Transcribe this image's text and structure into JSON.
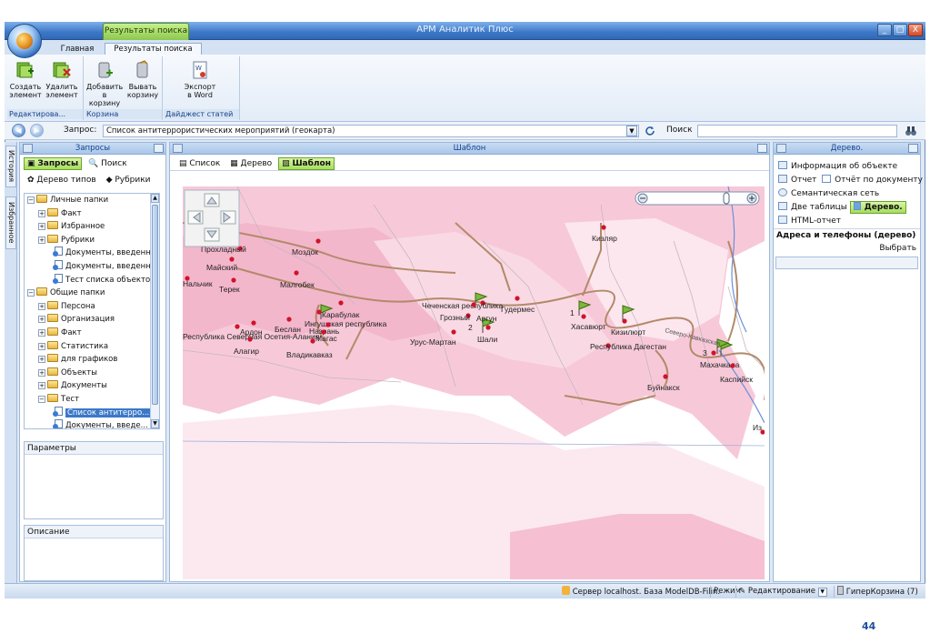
{
  "window": {
    "title": "АРМ Аналитик Плюс",
    "context_tab": "Результаты поиска",
    "controls": [
      "_",
      "□",
      "X"
    ]
  },
  "tabs": [
    "Главная",
    "Результаты поиска"
  ],
  "ribbon": {
    "groups": [
      {
        "label": "Редактирова...",
        "buttons": [
          {
            "line1": "Создать",
            "line2": "элемент"
          },
          {
            "line1": "Удалить",
            "line2": "элемент"
          }
        ]
      },
      {
        "label": "Корзина",
        "buttons": [
          {
            "line1": "Добавить",
            "line2": "в корзину"
          },
          {
            "line1": "Вывать",
            "line2": "корзину"
          }
        ]
      },
      {
        "label": "Дайджест статей",
        "buttons": [
          {
            "line1": "Экспорт",
            "line2": "в Word"
          }
        ]
      }
    ]
  },
  "querybar": {
    "label": "Запрос:",
    "value": "Список антитеррористических мероприятий (геокарта)",
    "search_label": "Поиск",
    "search_value": ""
  },
  "sidetabs": [
    "История",
    "Избранное"
  ],
  "left_panel": {
    "title": "Запросы",
    "toolbar": [
      "Запросы",
      "Поиск",
      "Дерево типов",
      "Рубрики"
    ],
    "tree": [
      {
        "text": "Личные папки",
        "level": 0,
        "type": "folder",
        "exp": "−"
      },
      {
        "text": "Факт",
        "level": 1,
        "type": "folder",
        "exp": "+"
      },
      {
        "text": "Избранное",
        "level": 1,
        "type": "folder",
        "exp": "+"
      },
      {
        "text": "Рубрики",
        "level": 1,
        "type": "folder",
        "exp": "+"
      },
      {
        "text": "Документы, введенн...",
        "level": 2,
        "type": "doc",
        "exp": ""
      },
      {
        "text": "Документы, введенн...",
        "level": 2,
        "type": "doc",
        "exp": ""
      },
      {
        "text": "Тест списка объектов",
        "level": 2,
        "type": "doc",
        "exp": ""
      },
      {
        "text": "Общие папки",
        "level": 0,
        "type": "folder",
        "exp": "−"
      },
      {
        "text": "Персона",
        "level": 1,
        "type": "folder",
        "exp": "+"
      },
      {
        "text": "Организация",
        "level": 1,
        "type": "folder",
        "exp": "+"
      },
      {
        "text": "Факт",
        "level": 1,
        "type": "folder",
        "exp": "+"
      },
      {
        "text": "Статистика",
        "level": 1,
        "type": "folder",
        "exp": "+"
      },
      {
        "text": "для графиков",
        "level": 1,
        "type": "folder",
        "exp": "+"
      },
      {
        "text": "Объекты",
        "level": 1,
        "type": "folder",
        "exp": "+"
      },
      {
        "text": "Документы",
        "level": 1,
        "type": "folder",
        "exp": "+"
      },
      {
        "text": "Тест",
        "level": 1,
        "type": "folder",
        "exp": "−"
      },
      {
        "text": "Список антитерро...",
        "level": 2,
        "type": "doc",
        "exp": "",
        "selected": true
      },
      {
        "text": "Документы, введе...",
        "level": 2,
        "type": "doc",
        "exp": ""
      }
    ],
    "params_label": "Параметры",
    "desc_label": "Описание"
  },
  "center_panel": {
    "title": "Шаблон",
    "views": [
      "Список",
      "Дерево",
      "Шаблон"
    ],
    "active_view": "Шаблон"
  },
  "map": {
    "cities": [
      "Кизляр",
      "Моздок",
      "Майский",
      "Терек",
      "Малгобек",
      "Карабулак",
      "Ингушская республика",
      "Назрань",
      "Магас",
      "Беслан",
      "Ардон",
      "Республика Северная Осетия-Алания",
      "Алагир",
      "Владикавказ",
      "Чеченская республика",
      "Грозный",
      "Аргун",
      "Гудермес",
      "Урус-Мартан",
      "Шали",
      "Хасавюрт",
      "Кизилюрт",
      "Республика Дагестан",
      "Махачкала",
      "Каспийск",
      "Буйнакск",
      "Нальчик",
      "Прохладный",
      "Из",
      "Северо-Кавказская"
    ],
    "flag_numbers": [
      "1",
      "2",
      "3"
    ]
  },
  "right_panel": {
    "title": "Дерево.",
    "items": [
      "Информация об объекте",
      "Отчет",
      "Отчёт по документу",
      "Семантическая сеть",
      "Две таблицы",
      "Дерево.",
      "HTML-отчет"
    ],
    "section_title": "Адреса и телефоны (дерево)",
    "select_label": "Выбрать"
  },
  "statusbar": {
    "server": "Сервер localhost. База ModelDB-Filin.",
    "mode_label": "Режим",
    "mode_value": "Редактирование",
    "basket": "ГиперКорзина (7)"
  },
  "page_number": "44",
  "colors": {
    "accent": "#3d78c7",
    "active_green": "#a6dd5c",
    "map_fill": "#f7c9d8",
    "road": "#b28a6a"
  }
}
